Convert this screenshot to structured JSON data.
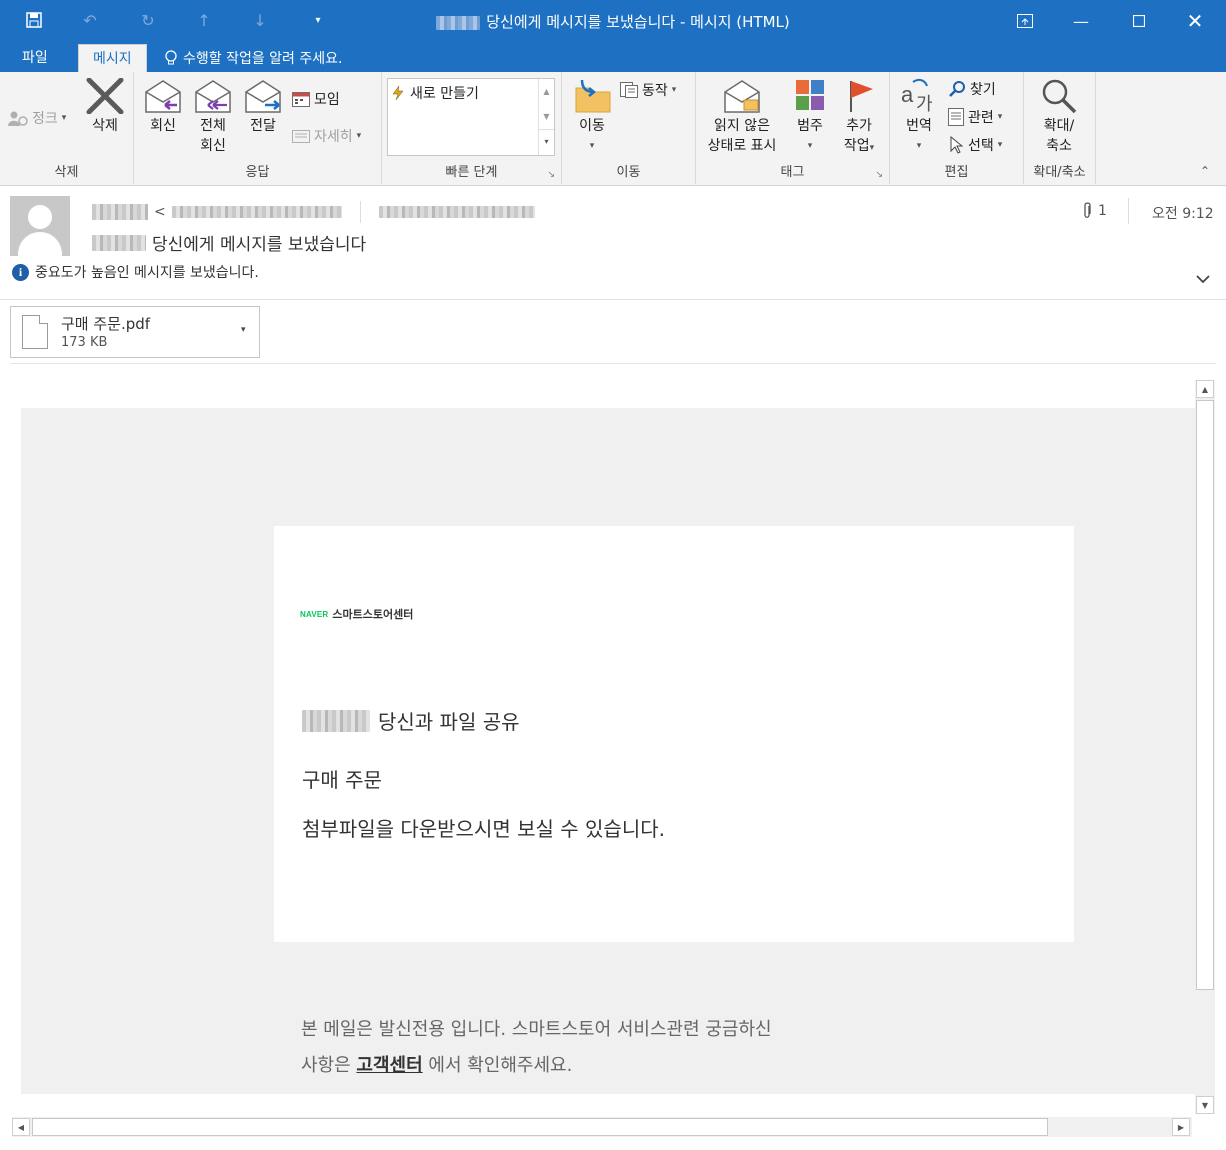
{
  "window": {
    "title": "당신에게 메시지를 보냈습니다 - 메시지 (HTML)",
    "sender_name_redacted": true
  },
  "tabs": {
    "file": "파일",
    "message": "메시지",
    "tell_me": "수행할 작업을 알려 주세요."
  },
  "ribbon": {
    "delete_group": {
      "ignore": "정크",
      "delete": "삭제",
      "label": "삭제"
    },
    "respond_group": {
      "reply": "회신",
      "reply_all_1": "전체",
      "reply_all_2": "회신",
      "forward": "전달",
      "meeting": "모임",
      "more": "자세히",
      "label": "응답"
    },
    "quick_steps": {
      "new": "새로 만들기",
      "label": "빠른 단계"
    },
    "move_group": {
      "move": "이동",
      "actions": "동작",
      "label": "이동"
    },
    "tags_group": {
      "unread_1": "읽지 않은",
      "unread_2": "상태로 표시",
      "categorize": "범주",
      "followup_1": "추가",
      "followup_2": "작업",
      "label": "태그"
    },
    "editing_group": {
      "translate": "번역",
      "find": "찾기",
      "related": "관련",
      "select": "선택",
      "label": "편집"
    },
    "zoom_group": {
      "zoom_1": "확대/",
      "zoom_2": "축소",
      "label": "확대/축소"
    }
  },
  "header": {
    "subject": "당신에게 메시지를 보냈습니다",
    "importance_notice": "중요도가 높음인 메시지를 보냈습니다.",
    "attachment_count": "1",
    "time": "오전 9:12"
  },
  "attachment": {
    "name": "구매 주문.pdf",
    "size": "173 KB"
  },
  "body": {
    "brand_naver": "NAVER",
    "brand_name": "스마트스토어센터",
    "share_line": "당신과 파일 공유",
    "title": "구매 주문",
    "message": "첨부파일을 다운받으시면 보실 수 있습니다.",
    "footer_line1": "본 메일은 발신전용 입니다. 스마트스토어 서비스관련 궁금하신",
    "footer_line2_prefix": "사항은",
    "footer_link": "고객센터",
    "footer_line2_suffix": "에서 확인해주세요."
  },
  "colors": {
    "accent": "#1e71c2",
    "naver_green": "#03c75a"
  }
}
